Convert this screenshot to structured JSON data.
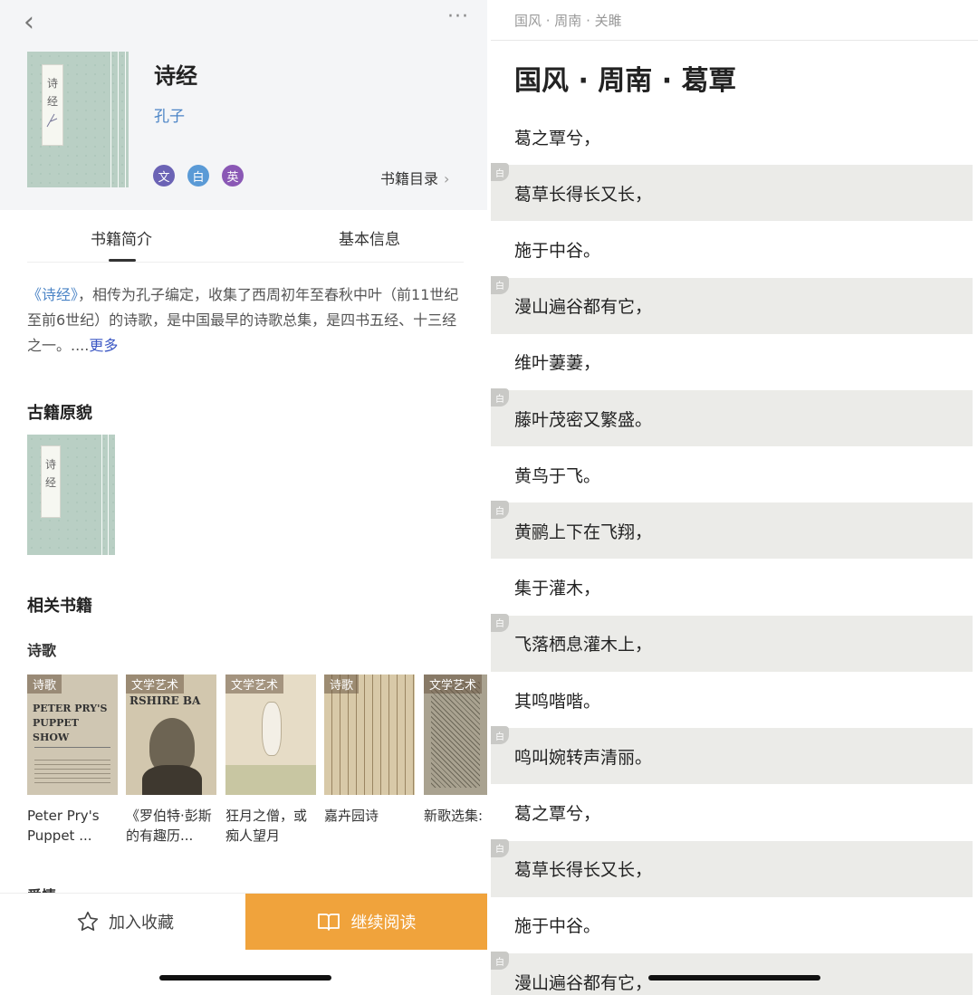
{
  "left": {
    "book": {
      "title": "诗经",
      "author": "孔子",
      "cover_text": [
        "诗",
        "经"
      ],
      "languages": [
        {
          "label": "文",
          "color": "#6b63b5"
        },
        {
          "label": "白",
          "color": "#5a9ad6"
        },
        {
          "label": "英",
          "color": "#8a58b5"
        }
      ],
      "catalog_label": "书籍目录"
    },
    "tabs": [
      "书籍简介",
      "基本信息"
    ],
    "intro": {
      "book_ref": "《诗经》",
      "text": "，相传为孔子编定，收集了西周初年至春秋中叶（前11世纪至前6世纪）的诗歌，是中国最早的诗歌总集，是四书五经、十三经之一。....",
      "more": "更多"
    },
    "original_heading": "古籍原貌",
    "related_heading": "相关书籍",
    "category_heading": "诗歌",
    "next_heading_partial": "爱情",
    "related": [
      {
        "tag": "诗歌",
        "caption": "Peter Pry's Puppet ...",
        "thumb_text": "PETER PRY'S PUPPET SHOW"
      },
      {
        "tag": "文学艺术",
        "caption": "《罗伯特·彭斯的有趣历...",
        "thumb_text": "RSHIRE BA"
      },
      {
        "tag": "文学艺术",
        "caption": "狂月之僧，或痴人望月",
        "thumb_text": ""
      },
      {
        "tag": "诗歌",
        "caption": "嘉卉园诗",
        "thumb_text": ""
      },
      {
        "tag": "文学艺术",
        "caption": "新歌选集:《Lovely",
        "thumb_text": ""
      }
    ],
    "bottom": {
      "favorite": "加入收藏",
      "continue": "继续阅读"
    }
  },
  "right": {
    "breadcrumb": "国风 · 周南 · 关雎",
    "chapter_title": "国风 · 周南 · 葛覃",
    "badge": "白",
    "lines": [
      {
        "text": "葛之覃兮，",
        "shaded": false
      },
      {
        "text": "葛草长得长又长，",
        "shaded": true
      },
      {
        "text": "施于中谷。",
        "shaded": false
      },
      {
        "text": "漫山遍谷都有它，",
        "shaded": true
      },
      {
        "text": "维叶萋萋，",
        "shaded": false
      },
      {
        "text": "藤叶茂密又繁盛。",
        "shaded": true
      },
      {
        "text": "黄鸟于飞。",
        "shaded": false
      },
      {
        "text": "黄鹂上下在飞翔，",
        "shaded": true
      },
      {
        "text": "集于灌木，",
        "shaded": false
      },
      {
        "text": "飞落栖息灌木上，",
        "shaded": true
      },
      {
        "text": "其鸣喈喈。",
        "shaded": false
      },
      {
        "text": "鸣叫婉转声清丽。",
        "shaded": true
      },
      {
        "text": "葛之覃兮，",
        "shaded": false
      },
      {
        "text": "葛草长得长又长，",
        "shaded": true
      },
      {
        "text": "施于中谷。",
        "shaded": false
      },
      {
        "text": "漫山遍谷都有它，",
        "shaded": true
      }
    ]
  }
}
